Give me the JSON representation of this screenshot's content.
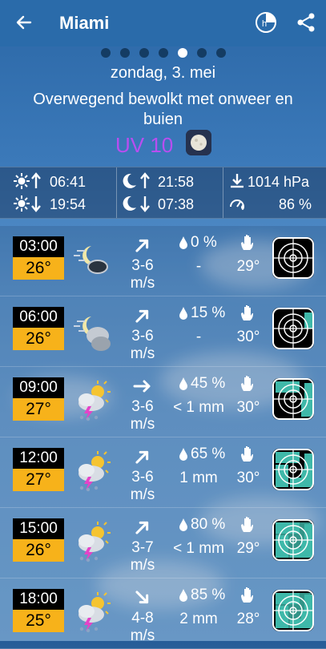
{
  "header": {
    "title": "Miami"
  },
  "pager": {
    "count": 7,
    "active": 4
  },
  "day": {
    "date": "zondag, 3. mei",
    "condition": "Overwegend bewolkt met onweer en buien",
    "uv": "UV 10"
  },
  "info": {
    "sunrise": "06:41",
    "sunset": "19:54",
    "moonrise": "21:58",
    "moonset": "07:38",
    "pressure": "1014 hPa",
    "humidity": "86 %"
  },
  "forecast": [
    {
      "time": "03:00",
      "temp": "26°",
      "icon": "night-cloud-moon-icon",
      "wind_dir": "ne",
      "wind": "3-6",
      "wind_unit": "m/s",
      "precip_pct": "0 %",
      "precip_amt": "-",
      "feels": "29°"
    },
    {
      "time": "06:00",
      "temp": "26°",
      "icon": "night-moon-cloud-icon",
      "wind_dir": "ne",
      "wind": "3-6",
      "wind_unit": "m/s",
      "precip_pct": "15 %",
      "precip_amt": "-",
      "feels": "30°"
    },
    {
      "time": "09:00",
      "temp": "27°",
      "icon": "thunderstorm-sun-icon",
      "wind_dir": "e",
      "wind": "3-6",
      "wind_unit": "m/s",
      "precip_pct": "45 %",
      "precip_amt": "< 1 mm",
      "feels": "30°"
    },
    {
      "time": "12:00",
      "temp": "27°",
      "icon": "thunderstorm-sun-icon",
      "wind_dir": "ne",
      "wind": "3-6",
      "wind_unit": "m/s",
      "precip_pct": "65 %",
      "precip_amt": "1 mm",
      "feels": "30°"
    },
    {
      "time": "15:00",
      "temp": "26°",
      "icon": "thunderstorm-sun-icon",
      "wind_dir": "ne",
      "wind": "3-7",
      "wind_unit": "m/s",
      "precip_pct": "80 %",
      "precip_amt": "< 1 mm",
      "feels": "29°"
    },
    {
      "time": "18:00",
      "temp": "25°",
      "icon": "thunderstorm-sun-icon",
      "wind_dir": "se",
      "wind": "4-8",
      "wind_unit": "m/s",
      "precip_pct": "85 %",
      "precip_amt": "2 mm",
      "feels": "28°"
    }
  ],
  "colors": {
    "topbar": "#2a6baa",
    "time_bg": "#000000",
    "temp_bg": "#f7b21a",
    "uv": "#b84ef0",
    "radar_teal": "#3fb8a9"
  }
}
